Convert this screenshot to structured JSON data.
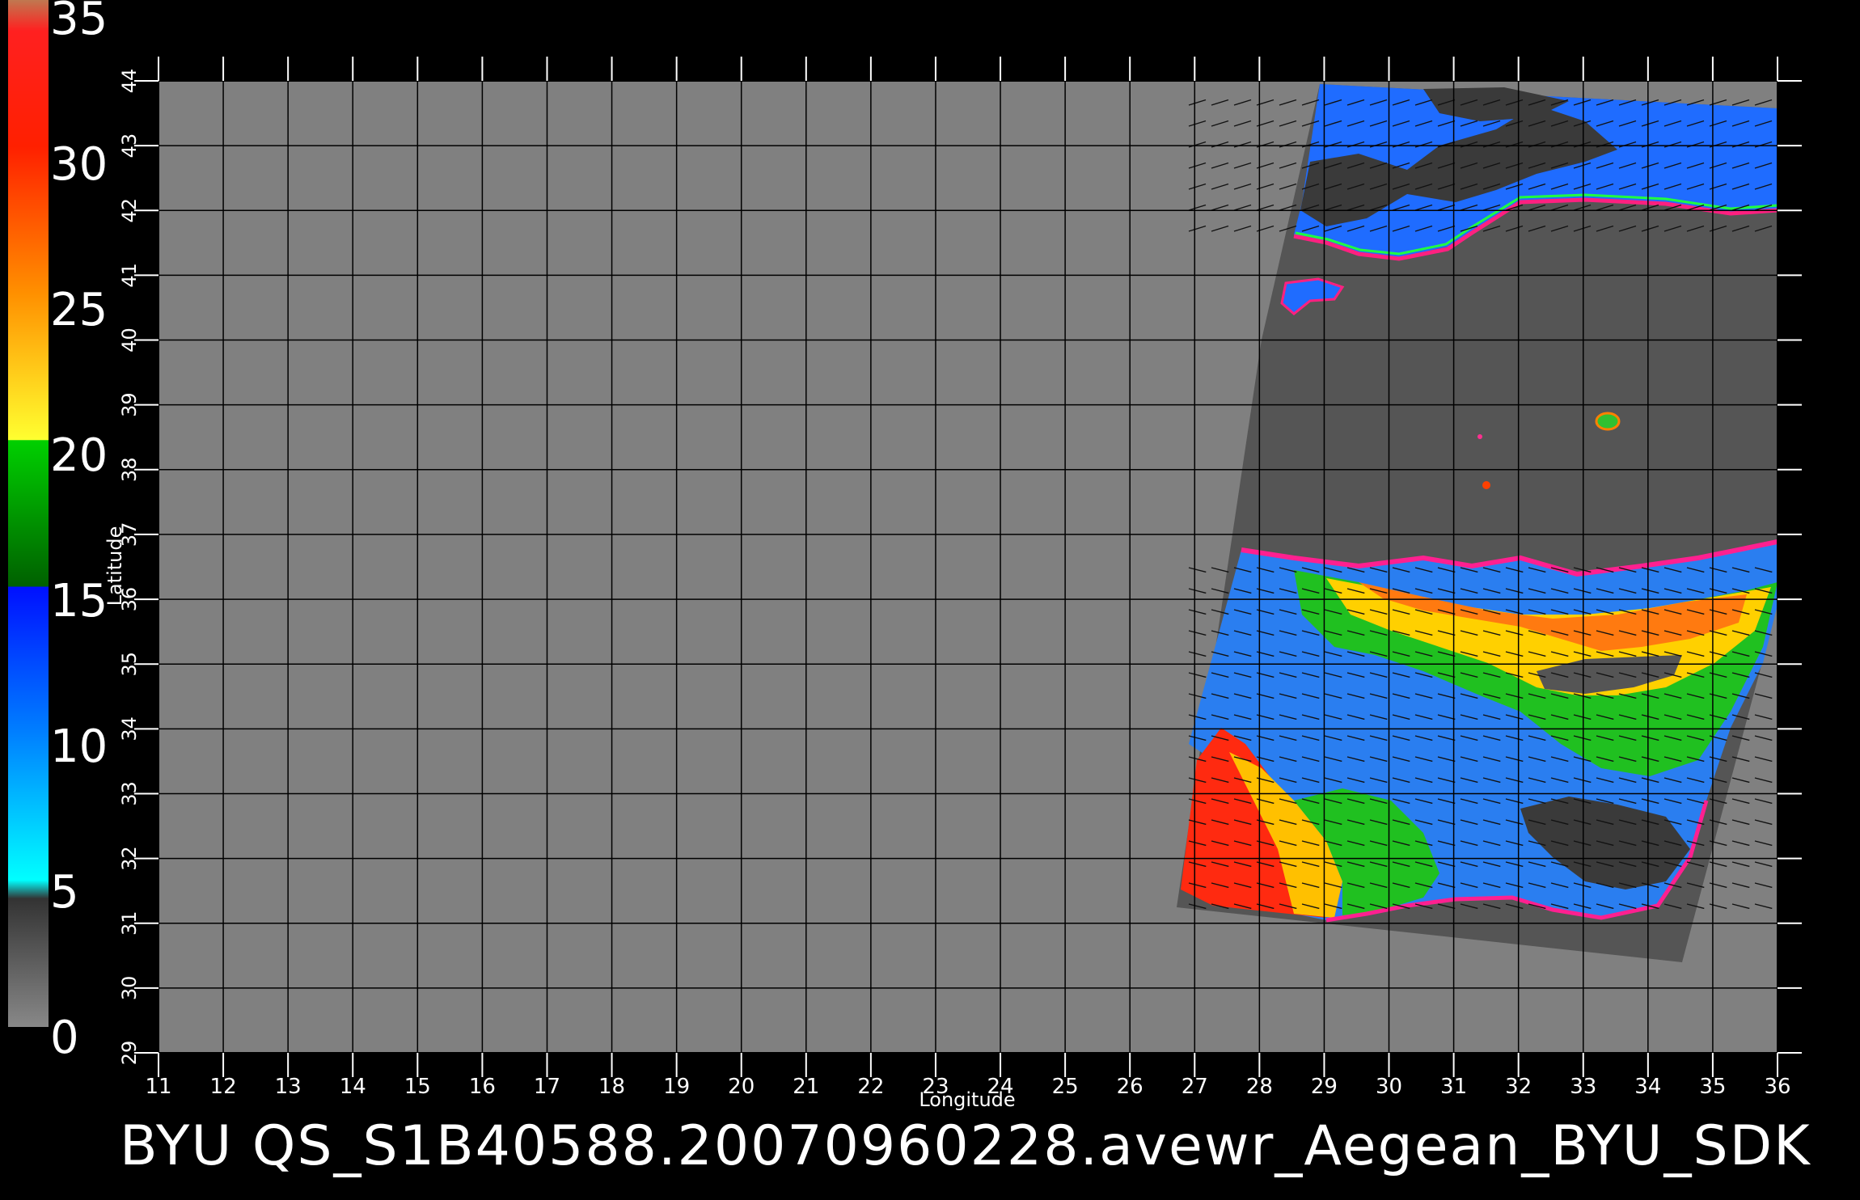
{
  "title": "BYU  QS_S1B40588.20070960228.avewr_Aegean_BYU_SDK",
  "colorbar": {
    "labels": [
      "35",
      "30",
      "25",
      "20",
      "15",
      "10",
      "5",
      "0"
    ],
    "stops": [
      {
        "color": "#5a5a5a",
        "label": "0"
      },
      {
        "color": "#00e8ff",
        "label": "5"
      },
      {
        "color": "#0030ff",
        "label": "10"
      },
      {
        "color": "#00c000",
        "label": "15"
      },
      {
        "color": "#ffe000",
        "label": "20"
      },
      {
        "color": "#ff7000",
        "label": "25"
      },
      {
        "color": "#ff1010",
        "label": "30"
      },
      {
        "color": "#c07850",
        "label": "35"
      }
    ]
  },
  "axes": {
    "xlabel": "Longitude",
    "ylabel": "Latitude",
    "x_ticks": [
      "11",
      "12",
      "13",
      "14",
      "15",
      "16",
      "17",
      "18",
      "19",
      "20",
      "21",
      "22",
      "23",
      "24",
      "25",
      "26",
      "27",
      "28",
      "29",
      "30",
      "31",
      "32",
      "33",
      "34",
      "35",
      "36"
    ],
    "y_ticks": [
      "29",
      "30",
      "31",
      "32",
      "33",
      "34",
      "35",
      "36",
      "37",
      "38",
      "39",
      "40",
      "41",
      "42",
      "43",
      "44"
    ],
    "xlim": [
      11,
      36
    ],
    "ylim": [
      29,
      44
    ]
  },
  "colors": {
    "background": "#000000",
    "map_fill": "#808080",
    "swath_fill": "#555555",
    "land_dark": "#3a3a3a",
    "grid": "#000000",
    "text": "#ffffff"
  }
}
